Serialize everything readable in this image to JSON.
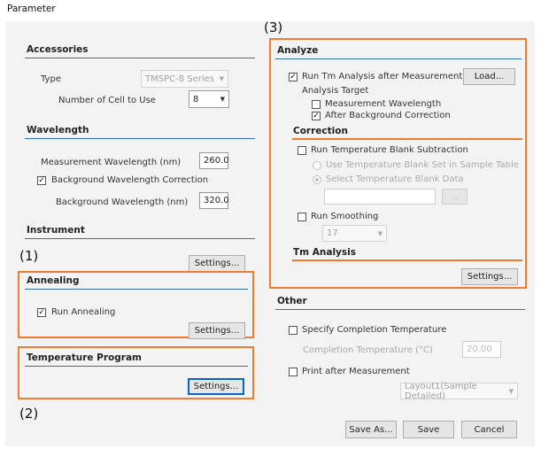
{
  "window": {
    "title": "Parameter"
  },
  "callouts": {
    "one": "(1)",
    "two": "(2)",
    "three": "(3)"
  },
  "accessories": {
    "heading": "Accessories",
    "type_label": "Type",
    "type_value": "TMSPC-8 Series",
    "cells_label": "Number of Cell to Use",
    "cells_value": "8"
  },
  "wavelength": {
    "heading": "Wavelength",
    "measurement_label": "Measurement Wavelength (nm)",
    "measurement_value": "260.0",
    "bg_correction_label": "Background Wavelength Correction",
    "bg_correction_checked": true,
    "bg_wavelength_label": "Background Wavelength (nm)",
    "bg_wavelength_value": "320.0"
  },
  "instrument": {
    "heading": "Instrument",
    "settings_label": "Settings..."
  },
  "annealing": {
    "heading": "Annealing",
    "run_label": "Run Annealing",
    "run_checked": true,
    "settings_label": "Settings..."
  },
  "temperature_program": {
    "heading": "Temperature Program",
    "settings_label": "Settings..."
  },
  "analyze": {
    "heading": "Analyze",
    "run_tm_label": "Run Tm Analysis after Measurement",
    "run_tm_checked": true,
    "load_label": "Load...",
    "target_label": "Analysis Target",
    "measurement_wl_label": "Measurement Wavelength",
    "measurement_wl_checked": false,
    "after_bg_label": "After Background Correction",
    "after_bg_checked": true
  },
  "correction": {
    "heading": "Correction",
    "blank_sub_label": "Run Temperature Blank Subtraction",
    "blank_sub_checked": false,
    "use_blank_label": "Use Temperature Blank Set in Sample Table",
    "select_blank_label": "Select Temperature Blank Data",
    "browse_label": "...",
    "smoothing_label": "Run Smoothing",
    "smoothing_checked": false,
    "smoothing_value": "17"
  },
  "tm_analysis": {
    "heading": "Tm Analysis",
    "settings_label": "Settings..."
  },
  "other": {
    "heading": "Other",
    "completion_label": "Specify Completion Temperature",
    "completion_checked": false,
    "completion_temp_label": "Completion Temperature (°C)",
    "completion_temp_value": "20.00",
    "print_label": "Print after Measurement",
    "print_checked": false,
    "layout_value": "Layout1(Sample Detailed)"
  },
  "footer": {
    "save_as": "Save As...",
    "save": "Save",
    "cancel": "Cancel"
  },
  "colors": {
    "accent_blue": "#2f6fb4",
    "highlight_orange": "#ee7d31"
  },
  "icons": {
    "check": "✓",
    "dropdown": "▼"
  }
}
